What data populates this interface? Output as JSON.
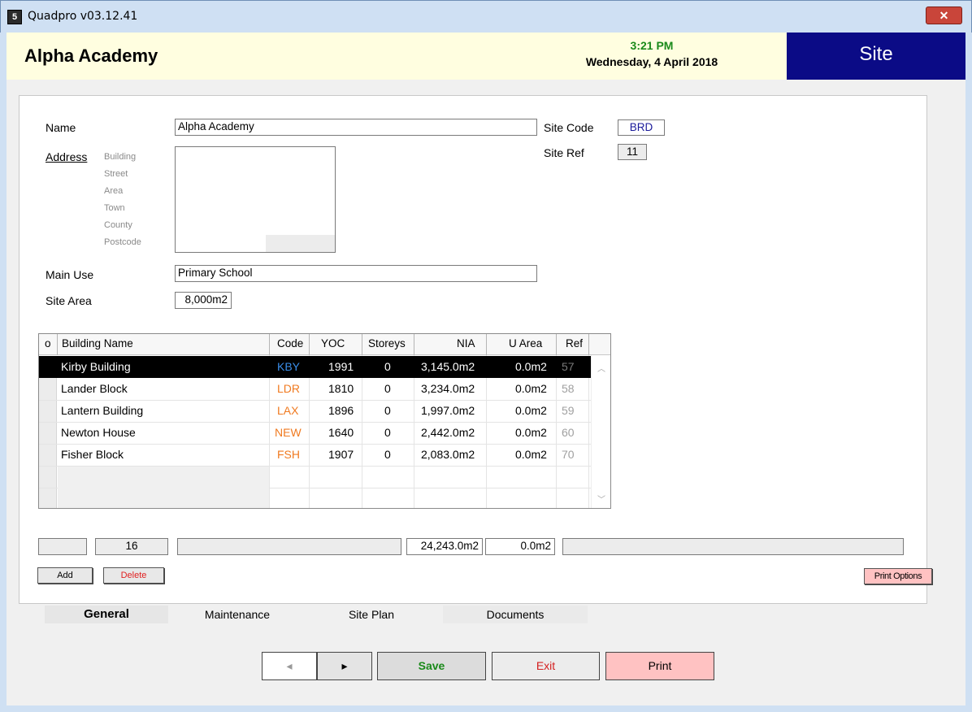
{
  "window": {
    "title": "Quadpro v03.12.41",
    "close_glyph": "✕"
  },
  "header": {
    "org_name": "Alpha Academy",
    "time": "3:21 PM",
    "date": "Wednesday, 4 April 2018",
    "section": "Site"
  },
  "form": {
    "name_label": "Name",
    "name_value": "Alpha Academy",
    "address_label": "Address",
    "address_parts": [
      "Building",
      "Street",
      "Area",
      "Town",
      "County",
      "Postcode"
    ],
    "site_code_label": "Site Code",
    "site_code_value": "BRD",
    "site_ref_label": "Site Ref",
    "site_ref_value": "11",
    "main_use_label": "Main Use",
    "main_use_value": "Primary School",
    "site_area_label": "Site Area",
    "site_area_value": "8,000m2"
  },
  "table": {
    "columns": [
      "o",
      "Building Name",
      "Code",
      "YOC",
      "Storeys",
      "NIA",
      "U Area",
      "Ref"
    ],
    "rows": [
      {
        "name": "Kirby Building",
        "code": "KBY",
        "yoc": "1991",
        "storeys": "0",
        "nia": "3,145.0m2",
        "uarea": "0.0m2",
        "ref": "57"
      },
      {
        "name": "Lander Block",
        "code": "LDR",
        "yoc": "1810",
        "storeys": "0",
        "nia": "3,234.0m2",
        "uarea": "0.0m2",
        "ref": "58"
      },
      {
        "name": "Lantern Building",
        "code": "LAX",
        "yoc": "1896",
        "storeys": "0",
        "nia": "1,997.0m2",
        "uarea": "0.0m2",
        "ref": "59"
      },
      {
        "name": "Newton House",
        "code": "NEW",
        "yoc": "1640",
        "storeys": "0",
        "nia": "2,442.0m2",
        "uarea": "0.0m2",
        "ref": "60"
      },
      {
        "name": "Fisher Block",
        "code": "FSH",
        "yoc": "1907",
        "storeys": "0",
        "nia": "2,083.0m2",
        "uarea": "0.0m2",
        "ref": "70"
      }
    ],
    "selected_row": 0
  },
  "totals": {
    "count": "16",
    "nia_total": "24,243.0m2",
    "uarea_total": "0.0m2"
  },
  "actions": {
    "add_label": "Add",
    "delete_label": "Delete",
    "print_options_label": "Print Options"
  },
  "tabs": [
    {
      "label": "General",
      "active": true
    },
    {
      "label": "Maintenance",
      "active": false
    },
    {
      "label": "Site Plan",
      "active": false
    },
    {
      "label": "Documents",
      "active": false
    }
  ],
  "nav": {
    "prev_glyph": "◂",
    "next_glyph": "▸",
    "save_label": "Save",
    "exit_label": "Exit",
    "print_label": "Print"
  },
  "colors": {
    "header_bg": "#fffee0",
    "section_bg": "#0b0b86",
    "time_color": "#1a8a1a",
    "save_color": "#1a8a1a",
    "exit_color": "#d42020",
    "print_bg": "#ffc2c2"
  }
}
